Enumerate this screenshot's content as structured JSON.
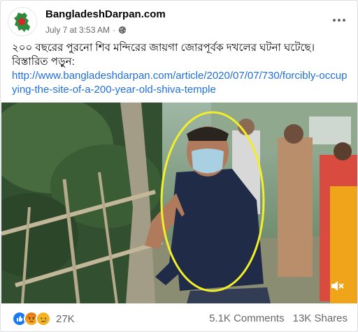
{
  "header": {
    "page_name": "BangladeshDarpan.com",
    "timestamp": "July 7 at 3:53 AM",
    "separator": "·",
    "privacy_icon": "globe-icon",
    "menu_icon": "more-horizontal-icon"
  },
  "post": {
    "text_line1": "২০০ বছরের পুরনো শিব মন্দিরের জায়গা জোরপূর্বক দখলের ঘটনা ঘটেছে।",
    "text_line2": "বিস্তারিত পড়ুন:",
    "link": "http://www.bangladeshdarpan.com/article/2020/07/07/730/forcibly-occupying-the-site-of-a-200-year-old-shiva-temple"
  },
  "media": {
    "mute_icon": "speaker-muted-icon",
    "highlight_color": "#f2ee2a"
  },
  "footer": {
    "reactions": [
      "like",
      "angry",
      "sad"
    ],
    "reaction_count": "27K",
    "comments": "5.1K Comments",
    "shares": "13K Shares"
  },
  "colors": {
    "link": "#216fdb",
    "secondary_text": "#65676b",
    "like": "#1877f2",
    "angry": "#e9710f",
    "sad": "#f7b125"
  }
}
